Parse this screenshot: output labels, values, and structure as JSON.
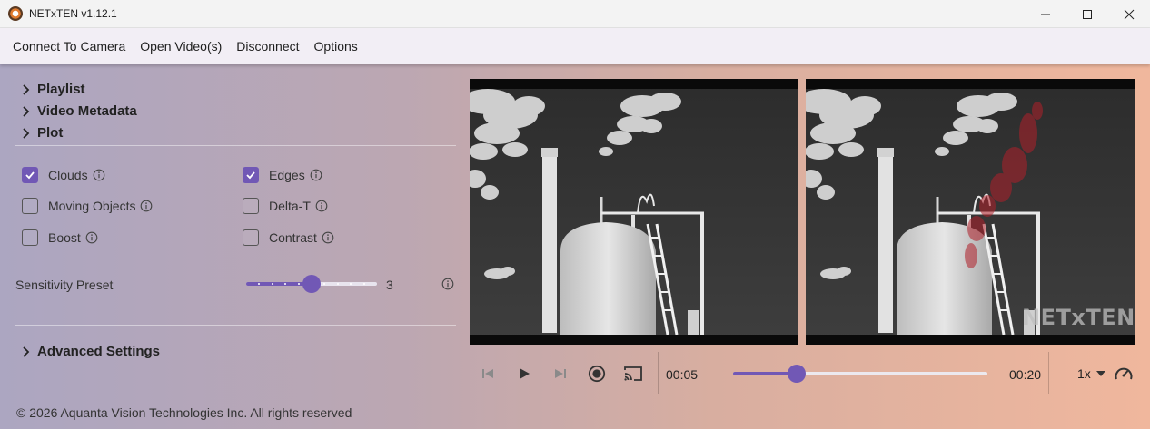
{
  "window": {
    "title": "NETxTEN v1.12.1",
    "icons": [
      "app-icon",
      "minimize-icon",
      "maximize-icon",
      "close-icon"
    ]
  },
  "menu": {
    "items": [
      {
        "label": "Connect To Camera"
      },
      {
        "label": "Open Video(s)"
      },
      {
        "label": "Disconnect"
      },
      {
        "label": "Options"
      }
    ]
  },
  "sidebar": {
    "sections": [
      {
        "label": "Playlist"
      },
      {
        "label": "Video Metadata"
      },
      {
        "label": "Plot"
      }
    ],
    "options": [
      {
        "label": "Clouds",
        "checked": true
      },
      {
        "label": "Edges",
        "checked": true
      },
      {
        "label": "Moving Objects",
        "checked": false
      },
      {
        "label": "Delta-T",
        "checked": false
      },
      {
        "label": "Boost",
        "checked": false
      },
      {
        "label": "Contrast",
        "checked": false
      }
    ],
    "sensitivity": {
      "label": "Sensitivity Preset",
      "value": "3",
      "min": 0,
      "max": 10,
      "fraction": 0.5
    },
    "advanced": {
      "label": "Advanced Settings"
    }
  },
  "player": {
    "watermark": "NETxTEN",
    "current_time": "00:05",
    "total_time": "00:20",
    "progress_fraction": 0.25,
    "speed": "1x",
    "icons": [
      "skip-previous-icon",
      "play-icon",
      "skip-next-icon",
      "record-icon",
      "cast-icon",
      "chevron-down-icon",
      "speedometer-icon"
    ]
  },
  "footer": {
    "text": "© 2026 Aquanta Vision Technologies Inc. All rights reserved"
  },
  "colors": {
    "accent": "#7158b5",
    "detection_overlay": "#b0202a",
    "menubar_bg": "#f2eef5"
  }
}
